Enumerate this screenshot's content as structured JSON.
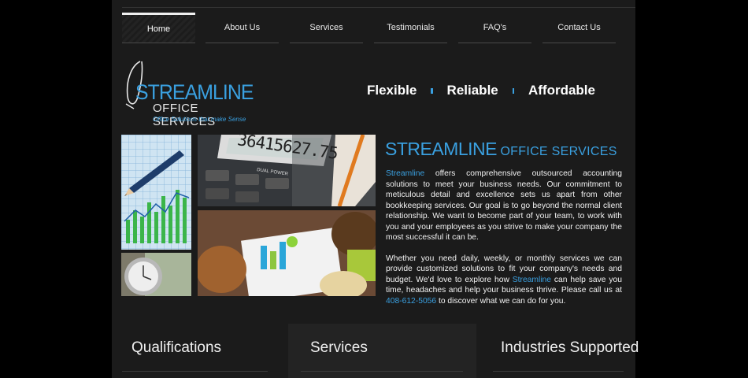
{
  "nav": {
    "items": [
      {
        "label": "Home",
        "active": true
      },
      {
        "label": "About Us",
        "active": false
      },
      {
        "label": "Services",
        "active": false
      },
      {
        "label": "Testimonials",
        "active": false
      },
      {
        "label": "FAQ's",
        "active": false
      },
      {
        "label": "Contact Us",
        "active": false
      }
    ]
  },
  "logo": {
    "main": "STREAMLINE",
    "sub": "OFFICE SERVICES",
    "tagline": "Office Solutions that make Sense"
  },
  "tagline": {
    "words": [
      "Flexible",
      "Reliable",
      "Affordable"
    ]
  },
  "photos": {
    "calculator_display": "36415627.75"
  },
  "intro": {
    "heading_big": "STREAMLINE",
    "heading_small": "OFFICE SERVICES",
    "p1_link": "Streamline",
    "p1_text": " offers comprehensive outsourced accounting solutions to meet your business needs. Our commitment to meticulous detail and excellence sets us apart from other bookkeeping services. Our goal is to go beyond the normal client relationship. We want to become part of your team, to work with you and your employees as you strive to make your company the most successful it can be.",
    "p2_text_a": "Whether you need daily, weekly, or monthly services we can provide customized solutions to fit your company's needs and budget. We'd love to explore how ",
    "p2_link": "Streamline",
    "p2_text_b": " can help save you time, headaches and help your business thrive. Please call us at ",
    "p2_phone": "408-612-5056",
    "p2_text_c": " to discover what we can do for you."
  },
  "columns": {
    "qualifications": "Qualifications",
    "services": "Services",
    "industries": "Industries Supported"
  },
  "colors": {
    "accent": "#3aa0e0",
    "background": "#1b1b1b"
  }
}
